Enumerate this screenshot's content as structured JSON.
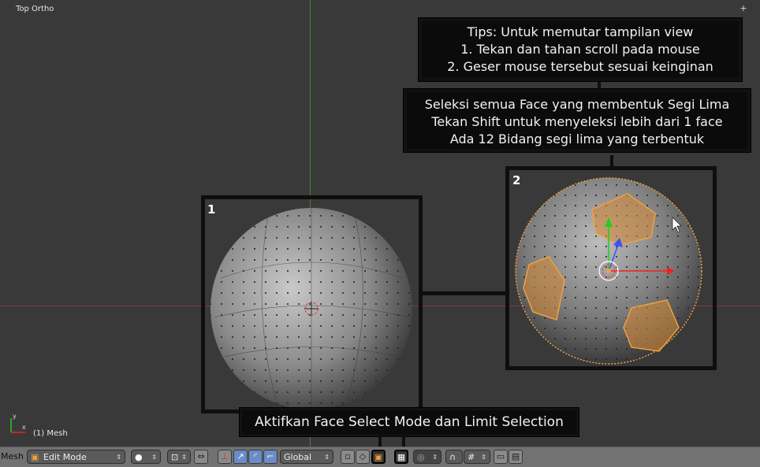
{
  "viewport": {
    "view_label": "Top Ortho",
    "object_label": "(1) Mesh",
    "corner_icon": "plus-icon"
  },
  "callouts": {
    "tips": {
      "line1": "Tips: Untuk memutar tampilan view",
      "line2": "1. Tekan dan tahan scroll pada mouse",
      "line3": "2. Geser mouse tersebut sesuai keinginan"
    },
    "seleksi": {
      "line1": "Seleksi semua Face yang membentuk Segi Lima",
      "line2": "Tekan Shift untuk menyeleksi lebih dari 1 face",
      "line3": "Ada 12 Bidang segi lima yang terbentuk"
    },
    "aktif": {
      "text": "Aktifkan Face Select Mode dan Limit Selection"
    }
  },
  "frames": {
    "frame1_number": "1",
    "frame2_number": "2"
  },
  "toolbar": {
    "menu_label": "Mesh",
    "mode": "Edit Mode",
    "orientation": "Global"
  },
  "colors": {
    "viewport_bg": "#393939",
    "grid_green": "#4f8a3a",
    "grid_red": "#8a3a3a",
    "selection_orange": "#f0a040",
    "toolbar_bg": "#727272"
  }
}
